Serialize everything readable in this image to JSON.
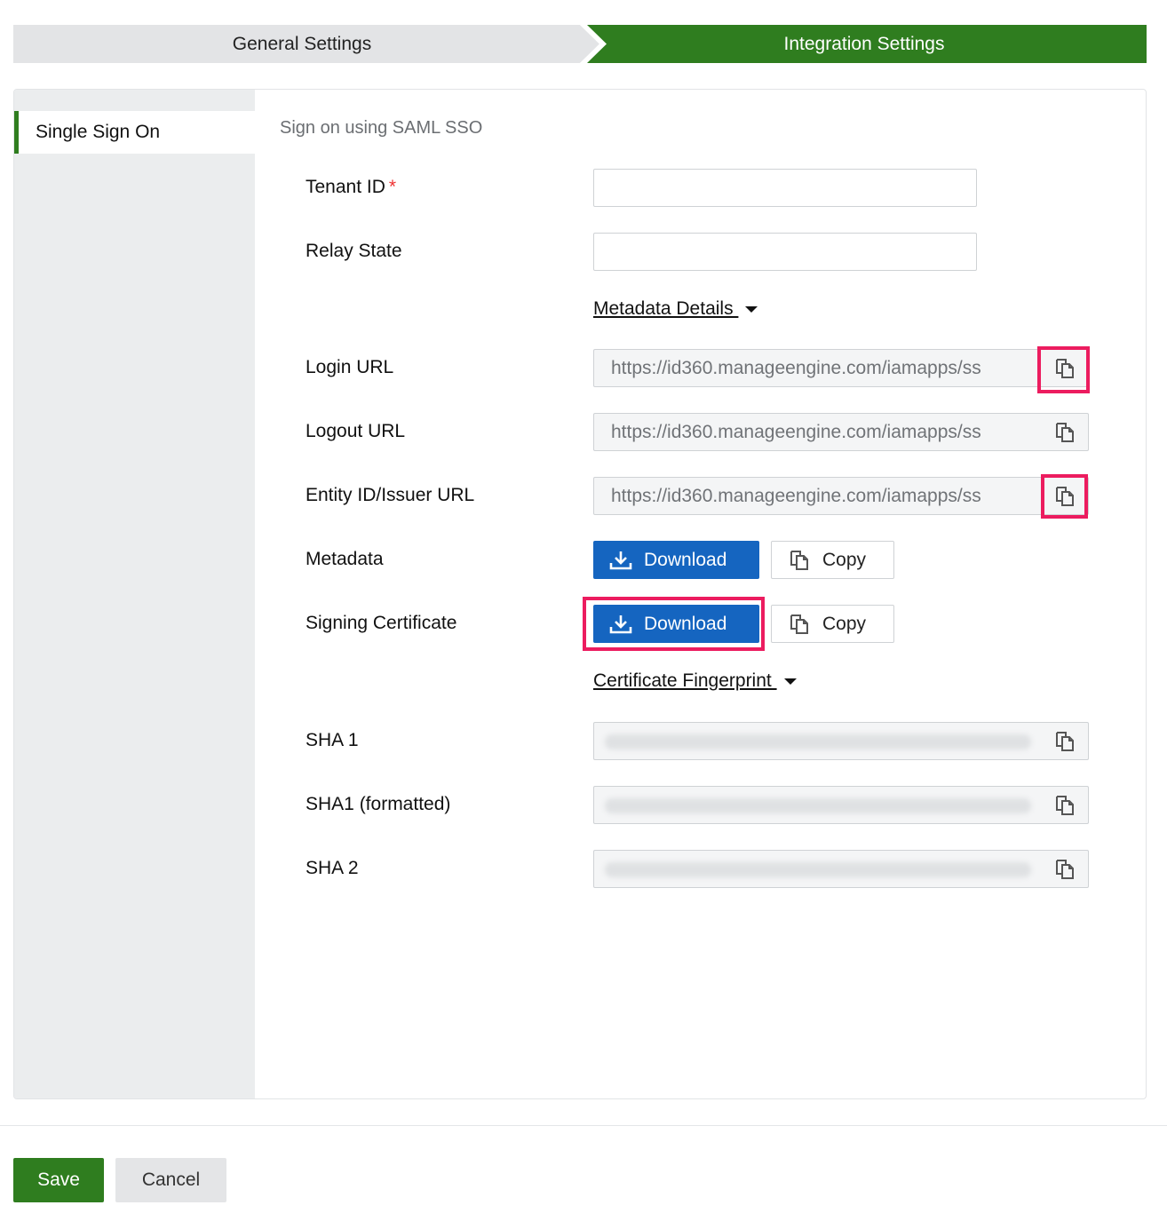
{
  "steps": {
    "general": "General Settings",
    "integration": "Integration Settings"
  },
  "sidebar": {
    "items": [
      {
        "label": "Single Sign On"
      }
    ]
  },
  "section": {
    "title": "Sign on using SAML SSO"
  },
  "fields": {
    "tenant_id": {
      "label": "Tenant ID",
      "required_mark": "*",
      "value": ""
    },
    "relay_state": {
      "label": "Relay State",
      "value": ""
    }
  },
  "metadata_details": {
    "label": "Metadata Details "
  },
  "urls": {
    "login": {
      "label": "Login URL",
      "value": "https://id360.manageengine.com/iamapps/ss"
    },
    "logout": {
      "label": "Logout URL",
      "value": "https://id360.manageengine.com/iamapps/ss"
    },
    "entity": {
      "label": "Entity ID/Issuer URL",
      "value": "https://id360.manageengine.com/iamapps/ss"
    }
  },
  "metadata": {
    "label": "Metadata",
    "download_label": "Download",
    "copy_label": "Copy"
  },
  "signing_certificate": {
    "label": "Signing Certificate",
    "download_label": "Download",
    "copy_label": "Copy"
  },
  "certificate_fingerprint": {
    "label": "Certificate Fingerprint "
  },
  "fingerprints": {
    "sha1": {
      "label": "SHA 1"
    },
    "sha1_formatted": {
      "label": "SHA1 (formatted)"
    },
    "sha2": {
      "label": "SHA 2"
    }
  },
  "footer": {
    "save_label": "Save",
    "cancel_label": "Cancel"
  },
  "colors": {
    "accent_green": "#2f7d1f",
    "primary_blue": "#1565c0",
    "highlight_pink": "#ec1c5f"
  },
  "icons": {
    "copy": "copy-icon",
    "download": "download-icon",
    "caret": "caret-down-icon"
  }
}
